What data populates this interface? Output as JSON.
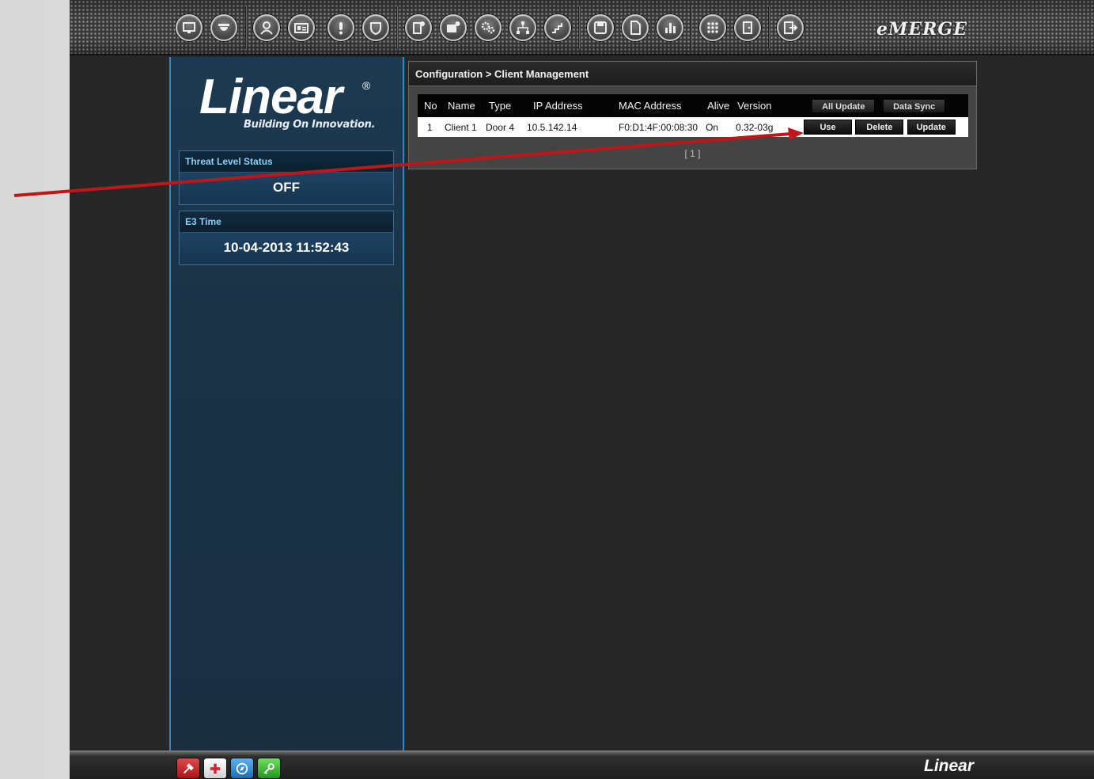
{
  "toolbar": {
    "brand": "eMERGE",
    "buttons": [
      {
        "name": "monitor-icon",
        "glyph": "▭"
      },
      {
        "name": "camera-icon",
        "glyph": "◒"
      },
      {
        "name": "person-icon",
        "glyph": "♙"
      },
      {
        "name": "id-card-icon",
        "glyph": "▤"
      },
      {
        "name": "alert-icon",
        "glyph": "!"
      },
      {
        "name": "shield-icon",
        "glyph": "⛉"
      },
      {
        "name": "door-settings-icon",
        "glyph": "⚙"
      },
      {
        "name": "camera-settings-icon",
        "glyph": "⚙"
      },
      {
        "name": "gears-icon",
        "glyph": "⚙"
      },
      {
        "name": "network-icon",
        "glyph": "☷"
      },
      {
        "name": "stairs-icon",
        "glyph": "⌐"
      },
      {
        "name": "save-icon",
        "glyph": "▣"
      },
      {
        "name": "document-icon",
        "glyph": "▯"
      },
      {
        "name": "bar-chart-icon",
        "glyph": "▥"
      },
      {
        "name": "keypad-icon",
        "glyph": "⁙"
      },
      {
        "name": "door-icon",
        "glyph": "▯"
      },
      {
        "name": "exit-icon",
        "glyph": "⇱"
      }
    ]
  },
  "sidebar": {
    "logo_word": "Linear",
    "logo_reg": "®",
    "logo_tagline": "Building On Innovation.",
    "threat": {
      "title": "Threat Level Status",
      "value": "OFF"
    },
    "time": {
      "title": "E3 Time",
      "value": "10-04-2013 11:52:43"
    }
  },
  "main": {
    "breadcrumb": "Configuration > Client Management",
    "columns": [
      "No",
      "Name",
      "Type",
      "IP Address",
      "MAC Address",
      "Alive",
      "Version"
    ],
    "header_buttons": {
      "all_update": "All Update",
      "data_sync": "Data Sync"
    },
    "rows": [
      {
        "no": "1",
        "name": "Client 1",
        "type": "Door 4",
        "ip": "10.5.142.14",
        "mac": "F0:D1:4F:00:08:30",
        "alive": "On",
        "version": "0.32-03g",
        "actions": {
          "use": "Use",
          "delete": "Delete",
          "update": "Update"
        }
      }
    ],
    "pager": "[ 1 ]"
  },
  "footer": {
    "logo": "Linear",
    "buttons": [
      {
        "name": "tools-icon",
        "glyph": "✎",
        "color": "#c8282c"
      },
      {
        "name": "first-aid-icon",
        "glyph": "✚",
        "color": "#f2f2f2"
      },
      {
        "name": "compass-icon",
        "glyph": "◎",
        "color": "#2d8fd6"
      },
      {
        "name": "key-icon",
        "glyph": "⚷",
        "color": "#3bbd33"
      }
    ]
  },
  "colors": {
    "accent": "#2a89c6",
    "annotation_arrow": "#c0161a",
    "app_bg": "#262626",
    "sidebar_bg": "#1d3a52"
  }
}
